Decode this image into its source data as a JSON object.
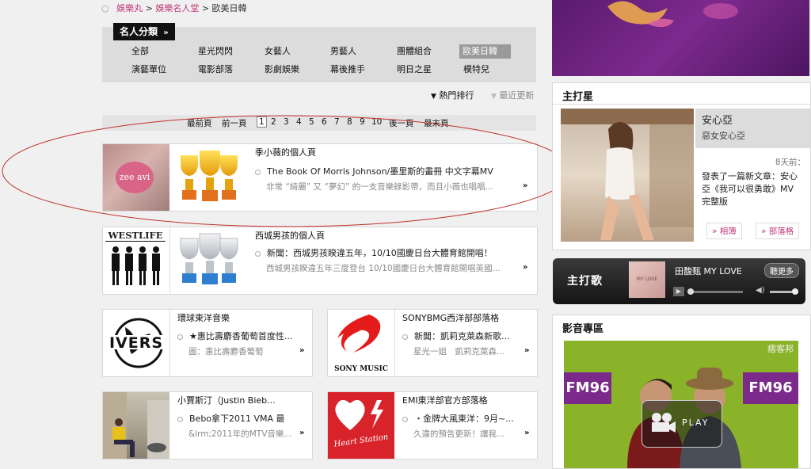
{
  "breadcrumb": {
    "items": [
      "娛樂丸",
      "娛樂名人堂",
      "歐美日韓"
    ],
    "sep": ">"
  },
  "categories": {
    "title": "名人分類",
    "title_arrow": "»",
    "items": [
      "全部",
      "星光閃閃",
      "女藝人",
      "男藝人",
      "團體組合",
      "歐美日韓",
      "演藝單位",
      "電影部落",
      "影劇娛樂",
      "幕後推手",
      "明日之星",
      "模特兒"
    ],
    "selected": "歐美日韓"
  },
  "sort": {
    "hot": "熱門排行",
    "recent": "最近更新"
  },
  "pager": {
    "first": "最前頁",
    "prev": "前一頁",
    "pages": [
      "1",
      "2",
      "3",
      "4",
      "5",
      "6",
      "7",
      "8",
      "9",
      "10"
    ],
    "current": "1",
    "next": "後一頁",
    "last": "最末頁"
  },
  "rows": [
    {
      "title": "季小薇的個人頁",
      "news": "The Book Of Morris Johnson/墨里斯的畫冊 中文字幕MV",
      "snippet": "非常 “綺麗” 又 “夢幻” 的一支音樂錄影帶，而且小薇也唱唱...",
      "logo_text": "zee avi"
    },
    {
      "title": "西城男孩的個人頁",
      "news": "新聞：西城男孩睽違五年，10/10國慶日台大體育館開唱！",
      "snippet": "西城男孩睽違五年三度登台 10/10國慶日台大體育館開唱英國...",
      "logo_text": "WESTLIFE"
    }
  ],
  "small_rows": [
    {
      "title": "環球東洋音樂",
      "news": "★惠比壽麝香葡萄首度性...",
      "snippet": "圖：惠比壽麝香葡萄",
      "logo_text": "IVERS"
    },
    {
      "title": "SONYBMG西洋部部落格",
      "news": "新聞：凱莉克萊森新歌...",
      "snippet": "星光一姐　凱莉克萊森...",
      "logo_text": "SONY MUSIC"
    },
    {
      "title": "小賈斯汀（Justin Bieb...",
      "news": "Bebo拿下2011 VMA 最",
      "snippet": "&lrm;2011年的MTV音樂...",
      "logo_text": ""
    },
    {
      "title": "EMI東洋部官方部落格",
      "news": "・金牌大風東洋：9月~...",
      "snippet": "久違的預告更新！讓我...",
      "logo_text": "Heart Station"
    }
  ],
  "more": "»",
  "star": {
    "heading": "主打星",
    "name": "安心亞",
    "subtitle": "惡女安心亞",
    "time": "8天前：",
    "text": "發表了一篇新文章：安心亞《我可以很勇敢》MV 完整版",
    "btn_album": "» 相簿",
    "btn_blog": "» 部落格"
  },
  "song": {
    "label": "主打歌",
    "title": "田馥甄 MY LOVE",
    "more": "聽更多",
    "cover_text": "MY LOVE"
  },
  "video": {
    "heading": "影音專區",
    "play": "PLAY",
    "fm_left": "FM96",
    "fm_right": "FM96",
    "watermark": "痞客邦"
  },
  "colors": {
    "accent": "#c0397a",
    "dark": "#111111",
    "selected": "#9a9a9a",
    "annotation": "#c0302a"
  }
}
